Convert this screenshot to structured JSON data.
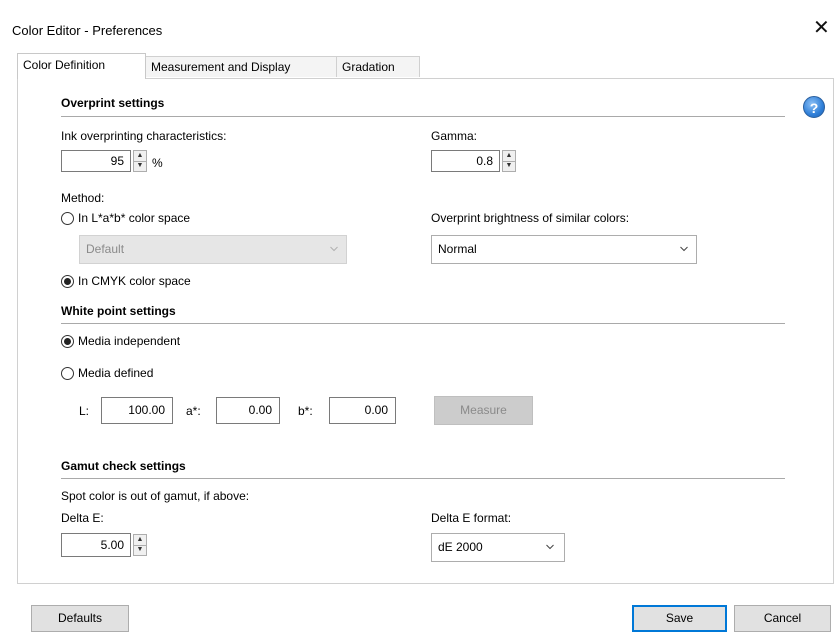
{
  "window": {
    "title": "Color Editor - Preferences",
    "close_glyph": "✕"
  },
  "tabs": [
    {
      "label": "Color Definition",
      "active": true
    },
    {
      "label": "Measurement and Display",
      "active": false
    },
    {
      "label": "Gradation",
      "active": false
    }
  ],
  "overprint": {
    "heading": "Overprint settings",
    "ink_label": "Ink overprinting characteristics:",
    "ink_value": "95",
    "ink_unit": "%",
    "gamma_label": "Gamma:",
    "gamma_value": "0.8",
    "method_label": "Method:",
    "lab_option": "In L*a*b* color space",
    "lab_selected": false,
    "lab_dropdown_value": "Default",
    "cmyk_option": "In CMYK color space",
    "cmyk_selected": true,
    "brightness_label": "Overprint brightness of similar colors:",
    "brightness_value": "Normal"
  },
  "white_point": {
    "heading": "White point settings",
    "independent_option": "Media independent",
    "independent_selected": true,
    "defined_option": "Media defined",
    "defined_selected": false,
    "l_label": "L:",
    "l_value": "100.00",
    "a_label": "a*:",
    "a_value": "0.00",
    "b_label": "b*:",
    "b_value": "0.00",
    "measure_button": "Measure"
  },
  "gamut": {
    "heading": "Gamut check settings",
    "description": "Spot color is out of gamut, if above:",
    "delta_label": "Delta E:",
    "delta_value": "5.00",
    "format_label": "Delta E format:",
    "format_value": "dE 2000"
  },
  "footer": {
    "defaults_button": "Defaults",
    "save_button": "Save",
    "cancel_button": "Cancel"
  },
  "help_glyph": "?",
  "icons": {
    "help": "help-icon",
    "close": "close-icon",
    "spin_up": "▲",
    "spin_down": "▼"
  },
  "colors": {
    "accent": "#0078d7",
    "help_blue": "#2f7fd8"
  }
}
